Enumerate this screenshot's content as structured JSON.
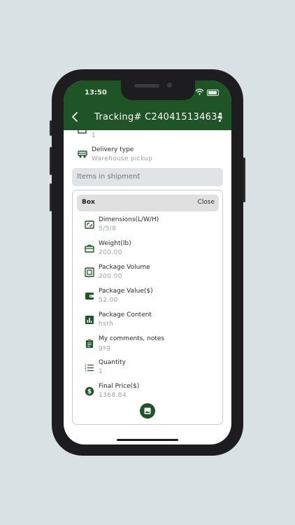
{
  "status_bar": {
    "time": "13:50"
  },
  "app_bar": {
    "title": "Tracking# C240415134634"
  },
  "pre_row": {
    "value": "1"
  },
  "delivery_type": {
    "label": "Delivery type",
    "value": "Warehouse pickup",
    "icon": "truck-icon"
  },
  "section": {
    "title": "Items in shipment"
  },
  "box": {
    "title": "Box",
    "close_label": "Close",
    "items": [
      {
        "label": "Dimensions(L/W/H)",
        "value": "5/5/8",
        "icon": "dimensions-icon"
      },
      {
        "label": "Weight(lb)",
        "value": "200.00",
        "icon": "scale-icon"
      },
      {
        "label": "Package Volume",
        "value": "200.00",
        "icon": "volume-icon"
      },
      {
        "label": "Package Value($)",
        "value": "52.00",
        "icon": "wallet-icon"
      },
      {
        "label": "Package Content",
        "value": "hsth",
        "icon": "content-chart-icon"
      },
      {
        "label": "My comments, notes",
        "value": "gsg",
        "icon": "clipboard-icon"
      },
      {
        "label": "Quantity",
        "value": "1",
        "icon": "list-icon"
      },
      {
        "label": "Final Price($)",
        "value": "1368.84",
        "icon": "dollar-icon"
      }
    ]
  },
  "colors": {
    "primary": "#1e5426",
    "muted_text": "#9aa4a0",
    "section_bg": "#e0e4e7",
    "page_bg": "#d9e1e4"
  }
}
